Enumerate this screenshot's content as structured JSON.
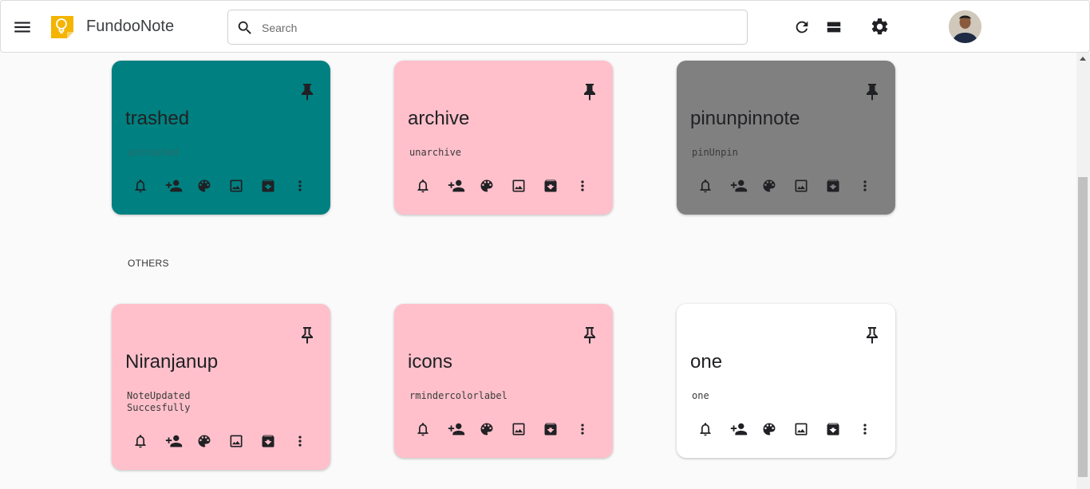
{
  "app": {
    "title": "FundooNote"
  },
  "search": {
    "placeholder": "Search",
    "value": ""
  },
  "colors": {
    "teal": "#008080",
    "pink": "#ffc0cb",
    "gray": "#808080",
    "white": "#ffffff",
    "logo": "#f4b400"
  },
  "icons": {
    "menu": "hamburger-menu-icon",
    "logo": "bulb-icon",
    "search": "search-icon",
    "refresh": "refresh-icon",
    "view": "list-view-icon",
    "settings": "gear-icon",
    "note_actions": [
      "bell-icon",
      "add-collaborator-icon",
      "palette-icon",
      "image-icon",
      "archive-icon",
      "more-vert-icon"
    ]
  },
  "sections": {
    "others_label": "OTHERS"
  },
  "pinned_notes": [
    {
      "title": "trashed",
      "description": "untrashed",
      "color": "teal",
      "pinned": true
    },
    {
      "title": "archive",
      "description": "unarchive",
      "color": "pink",
      "pinned": true
    },
    {
      "title": "pinunpinnote",
      "description": "pinUnpin",
      "color": "gray",
      "pinned": true
    }
  ],
  "other_notes": [
    {
      "title": "Niranjanup",
      "description": "NoteUpdated\nSuccesfully",
      "color": "pink",
      "pinned": false
    },
    {
      "title": "icons",
      "description": "rmindercolorlabel",
      "color": "pink",
      "pinned": false
    },
    {
      "title": "one",
      "description": "one",
      "color": "white",
      "pinned": false
    }
  ]
}
